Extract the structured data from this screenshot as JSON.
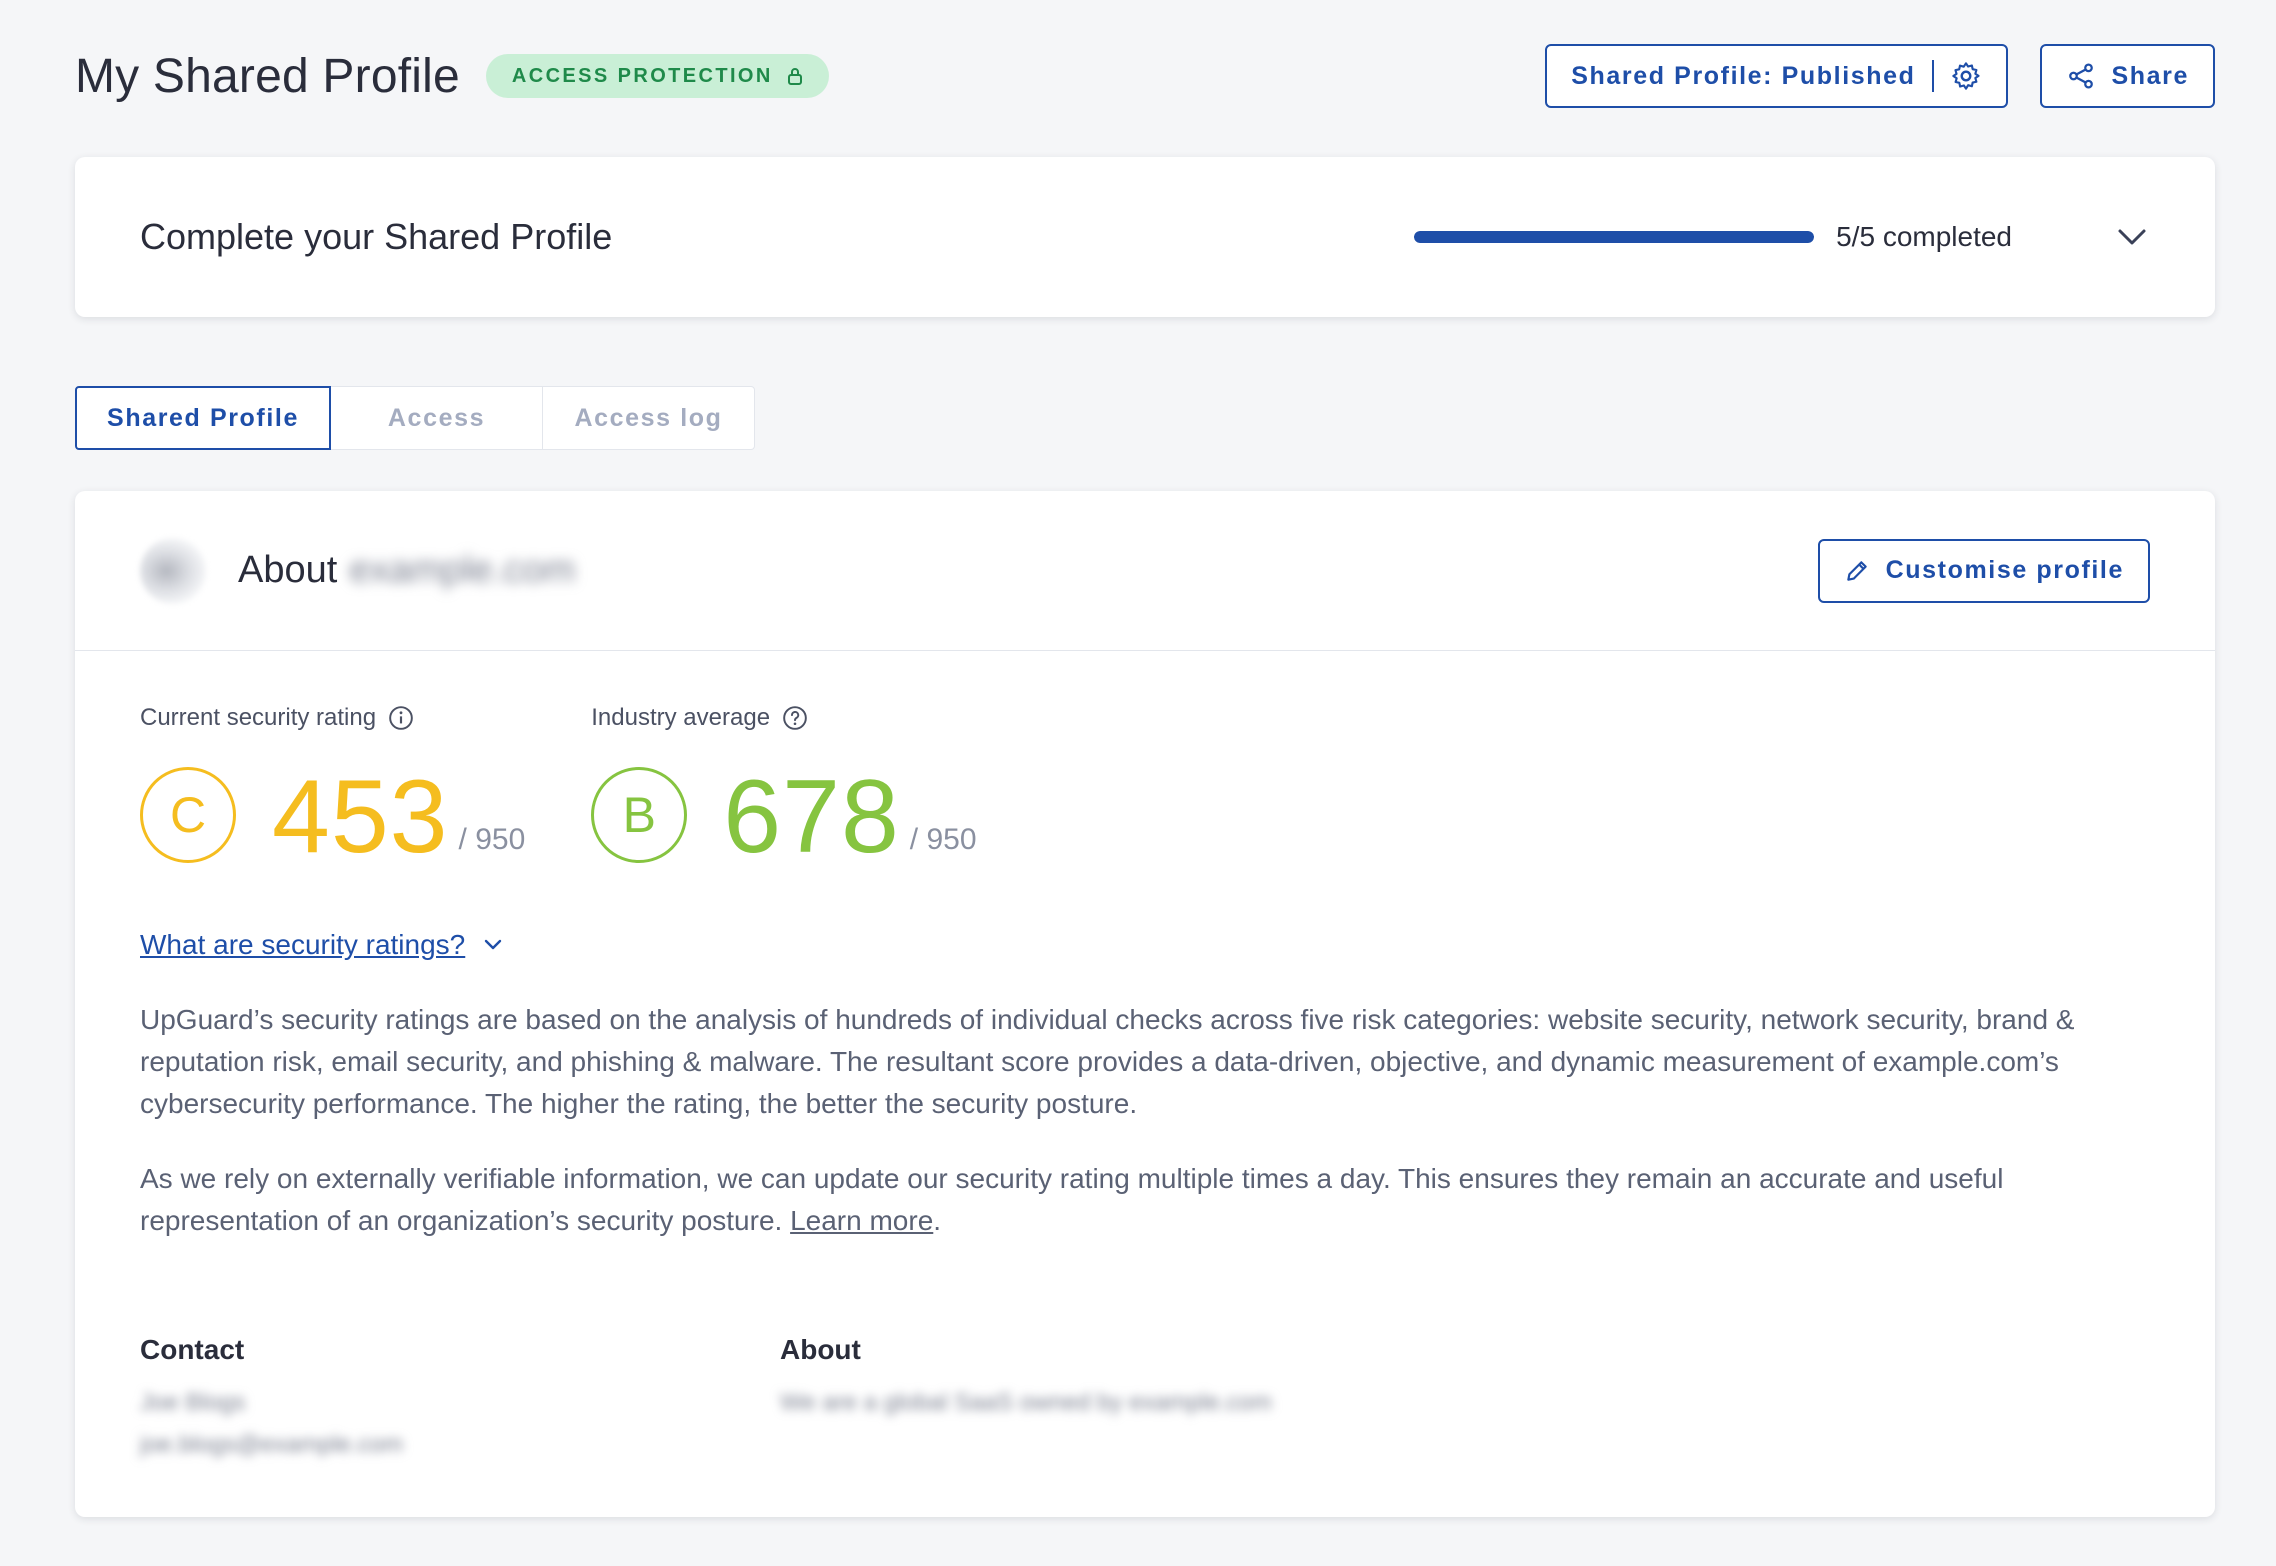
{
  "header": {
    "title": "My Shared Profile",
    "badge": "ACCESS PROTECTION",
    "published_label": "Shared Profile: Published",
    "share_label": "Share"
  },
  "progress": {
    "title": "Complete your Shared Profile",
    "value": 1.0,
    "text": "5/5 completed"
  },
  "tabs": [
    {
      "label": "Shared Profile",
      "active": true
    },
    {
      "label": "Access",
      "active": false
    },
    {
      "label": "Access log",
      "active": false
    }
  ],
  "about": {
    "prefix": "About",
    "domain": "example.com",
    "customise_label": "Customise profile"
  },
  "ratings": {
    "current": {
      "label": "Current security rating",
      "grade": "C",
      "score": "453",
      "out_of": "/ 950",
      "color": "#f5bd1f"
    },
    "industry": {
      "label": "Industry average",
      "grade": "B",
      "score": "678",
      "out_of": "/ 950",
      "color": "#86c440"
    }
  },
  "explainer": {
    "link": "What are security ratings?",
    "p1": "UpGuard’s security ratings are based on the analysis of hundreds of individual checks across five risk categories: website security, network security, brand & reputation risk, email security, and phishing & malware. The resultant score provides a data-driven, objective, and dynamic measurement of example.com’s cybersecurity performance. The higher the rating, the better the security posture.",
    "p2": "As we rely on externally verifiable information, we can update our security rating multiple times a day. This ensures they remain an accurate and useful representation of an organization’s security posture.",
    "learn_more": "Learn more",
    "p2_end": "."
  },
  "contact": {
    "title": "Contact",
    "name": "Joe Blogs",
    "email": "joe.blogs@example.com"
  },
  "about_section": {
    "title": "About",
    "text": "We are a global SaaS owned by example.com"
  },
  "colors": {
    "accent": "#1e4ea8",
    "badge_bg": "#c9efd6",
    "badge_text": "#1f8a4a"
  }
}
